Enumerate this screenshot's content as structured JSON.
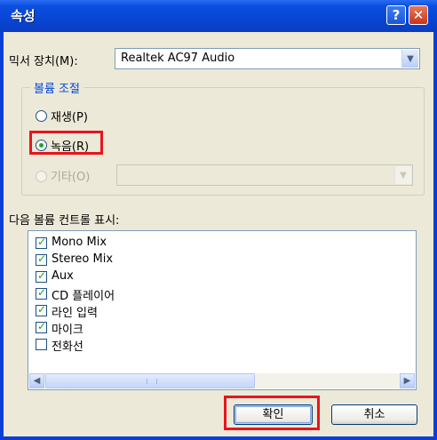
{
  "window": {
    "title": "속성",
    "help_glyph": "?",
    "close_glyph": "✕"
  },
  "mixer": {
    "label": "믹서 장치(M):",
    "value": "Realtek AC97 Audio"
  },
  "volume_group": {
    "title": "볼륨 조절",
    "options": [
      {
        "label": "재생(P)",
        "selected": false,
        "enabled": true
      },
      {
        "label": "녹음(R)",
        "selected": true,
        "enabled": true
      },
      {
        "label": "기타(O)",
        "selected": false,
        "enabled": false
      }
    ]
  },
  "controls": {
    "label": "다음 볼륨 컨트롤 표시:",
    "items": [
      {
        "label": "Mono Mix",
        "checked": true
      },
      {
        "label": "Stereo Mix",
        "checked": true
      },
      {
        "label": "Aux",
        "checked": true
      },
      {
        "label": "CD 플레이어",
        "checked": true
      },
      {
        "label": "라인 입력",
        "checked": true
      },
      {
        "label": "마이크",
        "checked": true
      },
      {
        "label": "전화선",
        "checked": false
      }
    ]
  },
  "buttons": {
    "ok": "확인",
    "cancel": "취소"
  },
  "colors": {
    "highlight": "#e8141e",
    "titlebar": "#0843d0",
    "check": "#21a121"
  }
}
